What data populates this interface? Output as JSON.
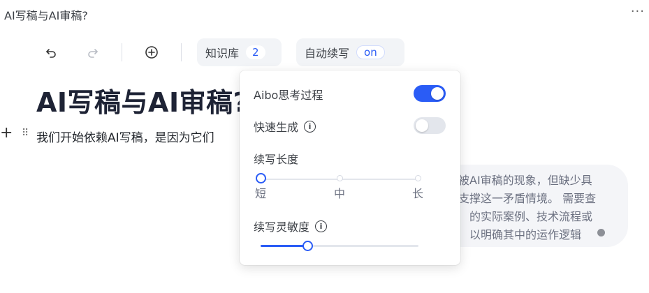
{
  "doc": {
    "title": "AI写稿与AI审稿?",
    "more_icon": "more-icon"
  },
  "toolbar": {
    "undo_icon": "undo-icon",
    "redo_icon": "redo-icon",
    "add_icon": "add-circle-icon",
    "knowledge_label": "知识库",
    "knowledge_count": "2",
    "auto_continue_label": "自动续写",
    "auto_continue_state": "on"
  },
  "editor": {
    "heading": "AI写稿与AI审稿?",
    "paragraph": "我们开始依赖AI写稿，是因为它们"
  },
  "suggestion": {
    "lines": [
      "被AI审稿的现象，但缺少具",
      "支撑这一矛盾情境。 需要查",
      "的实际案例、技术流程或",
      "以明确其中的运作逻辑"
    ]
  },
  "popup": {
    "aibo_label": "Aibo思考过程",
    "aibo_enabled": true,
    "fast_label": "快速生成",
    "fast_enabled": false,
    "length_label": "续写长度",
    "length_options": [
      "短",
      "中",
      "长"
    ],
    "length_selected": "短",
    "sensitivity_label": "续写灵敏度",
    "sensitivity_value": 0.3,
    "accent": "#2a5cf6"
  }
}
